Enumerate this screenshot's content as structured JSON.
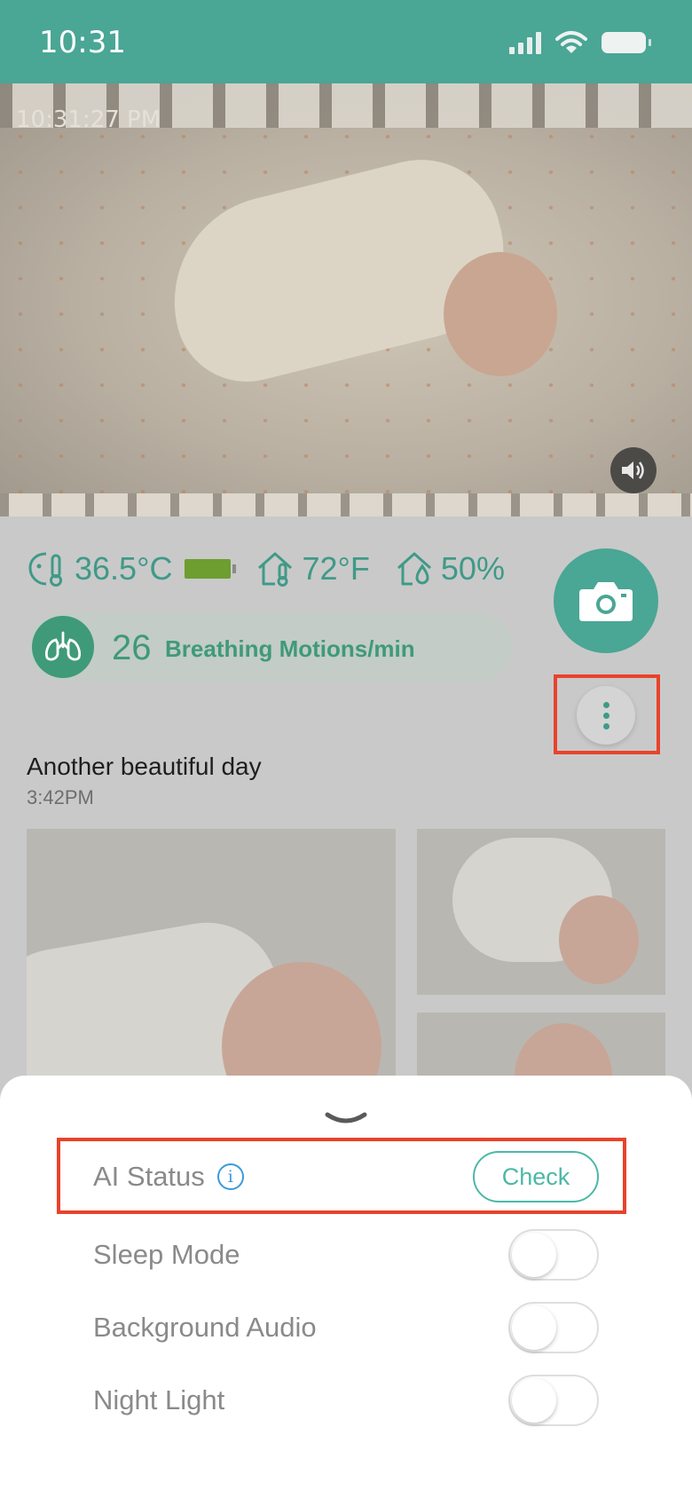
{
  "status_bar": {
    "time": "10:31"
  },
  "video": {
    "timestamp": "10:31:27 PM"
  },
  "vitals": {
    "skin_temperature": "36.5°C",
    "room_temperature": "72°F",
    "humidity": "50%",
    "sensor_battery_level": 1.0
  },
  "breathing": {
    "count": "26",
    "label": "Breathing Motions/min"
  },
  "moment": {
    "title": "Another beautiful day",
    "time": "3:42PM"
  },
  "settings": {
    "ai_status": {
      "label": "AI Status",
      "button_label": "Check"
    },
    "toggles": [
      {
        "label": "Sleep Mode",
        "on": false
      },
      {
        "label": "Background Audio",
        "on": false
      },
      {
        "label": "Night Light",
        "on": false
      }
    ]
  },
  "colors": {
    "brand": "#4aa695",
    "accent_text": "#3f9a88",
    "highlight": "#e8432b",
    "info": "#3a9bd8"
  },
  "icons": {
    "status": [
      "signal-icon",
      "wifi-icon",
      "battery-icon"
    ],
    "vitals": [
      "baby-thermometer-icon",
      "home-thermometer-icon",
      "home-humidity-icon"
    ],
    "actions": [
      "camera-icon",
      "more-vertical-icon",
      "speaker-icon",
      "lungs-icon",
      "chevron-down-icon",
      "info-icon"
    ]
  }
}
